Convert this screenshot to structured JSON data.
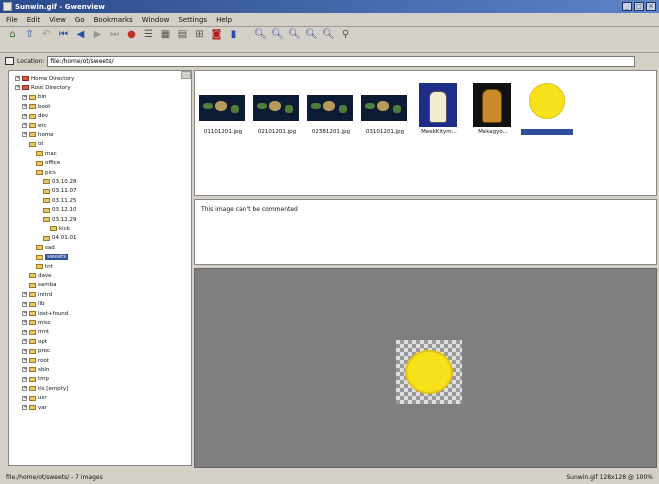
{
  "window": {
    "title": "Sunwin.gif - Gwenview",
    "buttons": [
      "_",
      "□",
      "×"
    ]
  },
  "menubar": [
    "File",
    "Edit",
    "View",
    "Go",
    "Bookmarks",
    "Window",
    "Settings",
    "Help"
  ],
  "toolbar": {
    "icons": [
      "home-icon",
      "up-icon",
      "back-icon",
      "first-image-icon",
      "previous-icon",
      "next-icon",
      "last-image-icon",
      "stop-icon",
      "list-view-icon",
      "thumbnail-view-icon",
      "tree-view-icon",
      "fullscreen-icon",
      "slideshow-icon",
      "zoom-in-icon",
      "zoom-out-icon",
      "zoom-reset-icon",
      "zoom-fit-icon",
      "zoom-lock-icon"
    ]
  },
  "location": {
    "label": "Location:",
    "value": "file:/home/ot/sweets/"
  },
  "tree": [
    {
      "label": "Home Directory",
      "depth": 0,
      "type": "home"
    },
    {
      "label": "Root Directory",
      "depth": 0,
      "type": "root"
    },
    {
      "label": "bin",
      "depth": 1
    },
    {
      "label": "boot",
      "depth": 1
    },
    {
      "label": "dev",
      "depth": 1
    },
    {
      "label": "etc",
      "depth": 1
    },
    {
      "label": "home",
      "depth": 1
    },
    {
      "label": "ot",
      "depth": 2
    },
    {
      "label": "mac",
      "depth": 3
    },
    {
      "label": "office",
      "depth": 3
    },
    {
      "label": "pics",
      "depth": 3
    },
    {
      "label": "03.10.28",
      "depth": 4
    },
    {
      "label": "03.11.07",
      "depth": 4
    },
    {
      "label": "03.11.25",
      "depth": 4
    },
    {
      "label": "03.12.10",
      "depth": 4
    },
    {
      "label": "03.12.29",
      "depth": 4
    },
    {
      "label": "kick",
      "depth": 5
    },
    {
      "label": "04.01.01",
      "depth": 4
    },
    {
      "label": "sad",
      "depth": 3
    },
    {
      "label": "sweets",
      "depth": 3,
      "selected": true
    },
    {
      "label": "tnt",
      "depth": 3
    },
    {
      "label": "dave",
      "depth": 2
    },
    {
      "label": "samba",
      "depth": 2
    },
    {
      "label": "initrd",
      "depth": 1
    },
    {
      "label": "lib",
      "depth": 1
    },
    {
      "label": "lost+found",
      "depth": 1
    },
    {
      "label": "misc",
      "depth": 1
    },
    {
      "label": "mnt",
      "depth": 1
    },
    {
      "label": "opt",
      "depth": 1
    },
    {
      "label": "proc",
      "depth": 1
    },
    {
      "label": "root",
      "depth": 1
    },
    {
      "label": "sbin",
      "depth": 1
    },
    {
      "label": "tmp",
      "depth": 1
    },
    {
      "label": "tls.[empty]",
      "depth": 1
    },
    {
      "label": "usr",
      "depth": 1
    },
    {
      "label": "var",
      "depth": 1
    }
  ],
  "thumbnails": [
    {
      "name": "01101201.jpg",
      "kind": "map"
    },
    {
      "name": "02101201.jpg",
      "kind": "map"
    },
    {
      "name": "02381201.jpg",
      "kind": "map"
    },
    {
      "name": "03101201.jpg",
      "kind": "map"
    },
    {
      "name": "MeekKitym...",
      "kind": "cat-blue"
    },
    {
      "name": "Mekagyo...",
      "kind": "cat-brown"
    },
    {
      "name": "Sunwin.gif",
      "kind": "sun",
      "selected": true
    }
  ],
  "comment": {
    "message": "This image can't be commented"
  },
  "status": {
    "left": "file:/home/ot/sweets/ - 7 images",
    "right": "Sunwin.gif 128x128 @ 100%"
  },
  "colors": {
    "title_gradient_start": "#2a4a8c",
    "selection": "#314e9a",
    "viewer_bg": "#7f7f7f",
    "sun": "#f6e11b"
  }
}
